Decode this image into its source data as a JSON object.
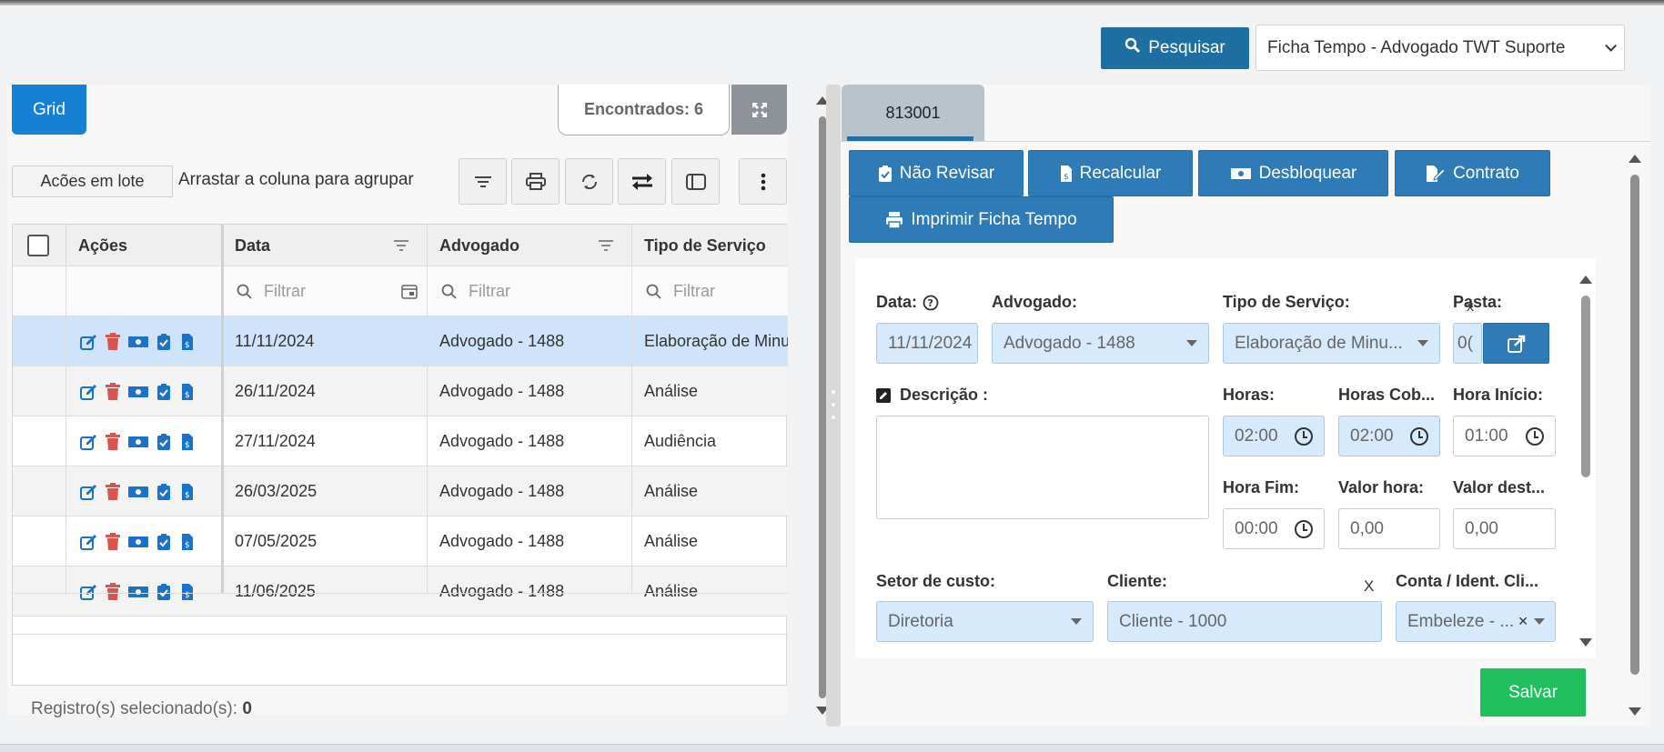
{
  "header": {
    "search_label": "Pesquisar",
    "profile_select": "Ficha Tempo - Advogado TWT Suporte"
  },
  "left": {
    "view_tab": "Grid",
    "found_label": "Encontrados: 6",
    "batch_actions": "Acões em lote",
    "group_hint": "Arrastar a coluna para agrupar",
    "columns": [
      "Ações",
      "Data",
      "Advogado",
      "Tipo de Serviço"
    ],
    "filter_placeholder": "Filtrar",
    "rows": [
      {
        "data": "11/11/2024",
        "advogado": "Advogado - 1488",
        "tipo": "Elaboração de Minuta"
      },
      {
        "data": "26/11/2024",
        "advogado": "Advogado - 1488",
        "tipo": "Análise"
      },
      {
        "data": "27/11/2024",
        "advogado": "Advogado - 1488",
        "tipo": "Audiência"
      },
      {
        "data": "26/03/2025",
        "advogado": "Advogado - 1488",
        "tipo": "Análise"
      },
      {
        "data": "07/05/2025",
        "advogado": "Advogado - 1488",
        "tipo": "Análise"
      },
      {
        "data": "11/06/2025",
        "advogado": "Advogado - 1488",
        "tipo": "Análise"
      }
    ],
    "selected_label": "Registro(s) selecionado(s):",
    "selected_count": "0"
  },
  "right": {
    "record_tab": "813001",
    "actions": {
      "nao_revisar": "Não Revisar",
      "recalcular": "Recalcular",
      "desbloquear": "Desbloquear",
      "contrato": "Contrato",
      "imprimir": "Imprimir Ficha Tempo"
    },
    "form": {
      "data_label": "Data:",
      "data_value": "11/11/2024",
      "advogado_label": "Advogado:",
      "advogado_value": "Advogado - 1488",
      "tipo_label": "Tipo de Serviço:",
      "tipo_value": "Elaboração de Minu...",
      "pasta_label": "Pasta:",
      "pasta_value": "0(",
      "descricao_label": "Descrição :",
      "horas_label": "Horas:",
      "horas_value": "02:00",
      "horas_cob_label": "Horas Cob...",
      "horas_cob_value": "02:00",
      "hora_inicio_label": "Hora Início:",
      "hora_inicio_value": "01:00",
      "hora_fim_label": "Hora Fim:",
      "hora_fim_value": "00:00",
      "valor_hora_label": "Valor hora:",
      "valor_hora_value": "0,00",
      "valor_dest_label": "Valor dest...",
      "valor_dest_value": "0,00",
      "setor_label": "Setor de custo:",
      "setor_value": "Diretoria",
      "cliente_label": "Cliente:",
      "cliente_value": "Cliente - 1000",
      "conta_label": "Conta / Ident. Cli...",
      "conta_value": "Embeleze - ..."
    },
    "save_label": "Salvar"
  },
  "colors": {
    "primary": "#2f7bb8",
    "grid_tab": "#1681d4",
    "save": "#20c05c",
    "selected_row": "#cfe4fb",
    "delete_icon": "#d9534f"
  }
}
